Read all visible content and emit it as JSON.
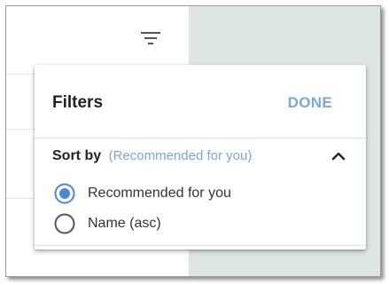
{
  "dialog": {
    "title": "Filters",
    "done_label": "DONE"
  },
  "sort": {
    "label": "Sort by",
    "current": "(Recommended for you)",
    "expanded": true,
    "options": [
      {
        "label": "Recommended for you",
        "selected": true
      },
      {
        "label": "Name (asc)",
        "selected": false
      }
    ]
  },
  "icons": {
    "toolbar": "filter-icon",
    "section_toggle": "chevron-up-icon",
    "radio_on": "radio-selected-icon",
    "radio_off": "radio-unselected-icon"
  },
  "colors": {
    "accent": "#7ba7d6",
    "radio_selected": "#4f86d0",
    "background_panel": "#dde6e3",
    "text": "#222222"
  }
}
